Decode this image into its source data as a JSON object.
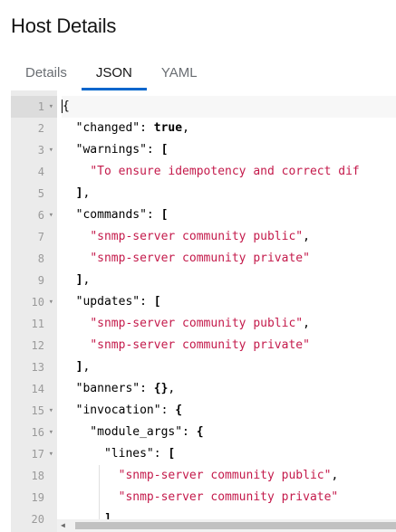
{
  "header": {
    "title": "Host Details"
  },
  "tabs": [
    {
      "label": "Details"
    },
    {
      "label": "JSON"
    },
    {
      "label": "YAML"
    }
  ],
  "editor": {
    "lines": [
      {
        "num": "1",
        "fold": true,
        "tokens": [
          {
            "t": "{",
            "c": "punct"
          }
        ]
      },
      {
        "num": "2",
        "fold": false,
        "tokens": [
          {
            "t": "  \"changed\": ",
            "c": "punct"
          },
          {
            "t": "true",
            "c": "kw"
          },
          {
            "t": ",",
            "c": "punct"
          }
        ]
      },
      {
        "num": "3",
        "fold": true,
        "tokens": [
          {
            "t": "  \"warnings\": ",
            "c": "punct"
          },
          {
            "t": "[",
            "c": "kw"
          }
        ]
      },
      {
        "num": "4",
        "fold": false,
        "tokens": [
          {
            "t": "    ",
            "c": "punct"
          },
          {
            "t": "\"To ensure idempotency and correct dif",
            "c": "str"
          }
        ]
      },
      {
        "num": "5",
        "fold": false,
        "tokens": [
          {
            "t": "  ",
            "c": "punct"
          },
          {
            "t": "]",
            "c": "kw"
          },
          {
            "t": ",",
            "c": "punct"
          }
        ]
      },
      {
        "num": "6",
        "fold": true,
        "tokens": [
          {
            "t": "  \"commands\": ",
            "c": "punct"
          },
          {
            "t": "[",
            "c": "kw"
          }
        ]
      },
      {
        "num": "7",
        "fold": false,
        "tokens": [
          {
            "t": "    ",
            "c": "punct"
          },
          {
            "t": "\"snmp-server community public\"",
            "c": "str"
          },
          {
            "t": ",",
            "c": "punct"
          }
        ]
      },
      {
        "num": "8",
        "fold": false,
        "tokens": [
          {
            "t": "    ",
            "c": "punct"
          },
          {
            "t": "\"snmp-server community private\"",
            "c": "str"
          }
        ]
      },
      {
        "num": "9",
        "fold": false,
        "tokens": [
          {
            "t": "  ",
            "c": "punct"
          },
          {
            "t": "]",
            "c": "kw"
          },
          {
            "t": ",",
            "c": "punct"
          }
        ]
      },
      {
        "num": "10",
        "fold": true,
        "tokens": [
          {
            "t": "  \"updates\": ",
            "c": "punct"
          },
          {
            "t": "[",
            "c": "kw"
          }
        ]
      },
      {
        "num": "11",
        "fold": false,
        "tokens": [
          {
            "t": "    ",
            "c": "punct"
          },
          {
            "t": "\"snmp-server community public\"",
            "c": "str"
          },
          {
            "t": ",",
            "c": "punct"
          }
        ]
      },
      {
        "num": "12",
        "fold": false,
        "tokens": [
          {
            "t": "    ",
            "c": "punct"
          },
          {
            "t": "\"snmp-server community private\"",
            "c": "str"
          }
        ]
      },
      {
        "num": "13",
        "fold": false,
        "tokens": [
          {
            "t": "  ",
            "c": "punct"
          },
          {
            "t": "]",
            "c": "kw"
          },
          {
            "t": ",",
            "c": "punct"
          }
        ]
      },
      {
        "num": "14",
        "fold": false,
        "tokens": [
          {
            "t": "  \"banners\": ",
            "c": "punct"
          },
          {
            "t": "{}",
            "c": "kw"
          },
          {
            "t": ",",
            "c": "punct"
          }
        ]
      },
      {
        "num": "15",
        "fold": true,
        "tokens": [
          {
            "t": "  \"invocation\": ",
            "c": "punct"
          },
          {
            "t": "{",
            "c": "kw"
          }
        ]
      },
      {
        "num": "16",
        "fold": true,
        "tokens": [
          {
            "t": "    \"module_args\": ",
            "c": "punct"
          },
          {
            "t": "{",
            "c": "kw"
          }
        ]
      },
      {
        "num": "17",
        "fold": true,
        "tokens": [
          {
            "t": "      \"lines\": ",
            "c": "punct"
          },
          {
            "t": "[",
            "c": "kw"
          }
        ]
      },
      {
        "num": "18",
        "fold": false,
        "tokens": [
          {
            "t": "        ",
            "c": "punct"
          },
          {
            "t": "\"snmp-server community public\"",
            "c": "str"
          },
          {
            "t": ",",
            "c": "punct"
          }
        ]
      },
      {
        "num": "19",
        "fold": false,
        "tokens": [
          {
            "t": "        ",
            "c": "punct"
          },
          {
            "t": "\"snmp-server community private\"",
            "c": "str"
          }
        ]
      },
      {
        "num": "20",
        "fold": false,
        "tokens": [
          {
            "t": "      ",
            "c": "punct"
          },
          {
            "t": "],",
            "c": "kw"
          }
        ]
      }
    ]
  },
  "colors": {
    "accent": "#0066cc",
    "string": "#c41a4b",
    "gutter": "#ebebeb"
  },
  "icons": {
    "fold": "chevron-down-icon",
    "scroll_left": "arrow-left-icon"
  },
  "glyphs": {
    "fold": "▾",
    "scroll_left": "◀"
  }
}
